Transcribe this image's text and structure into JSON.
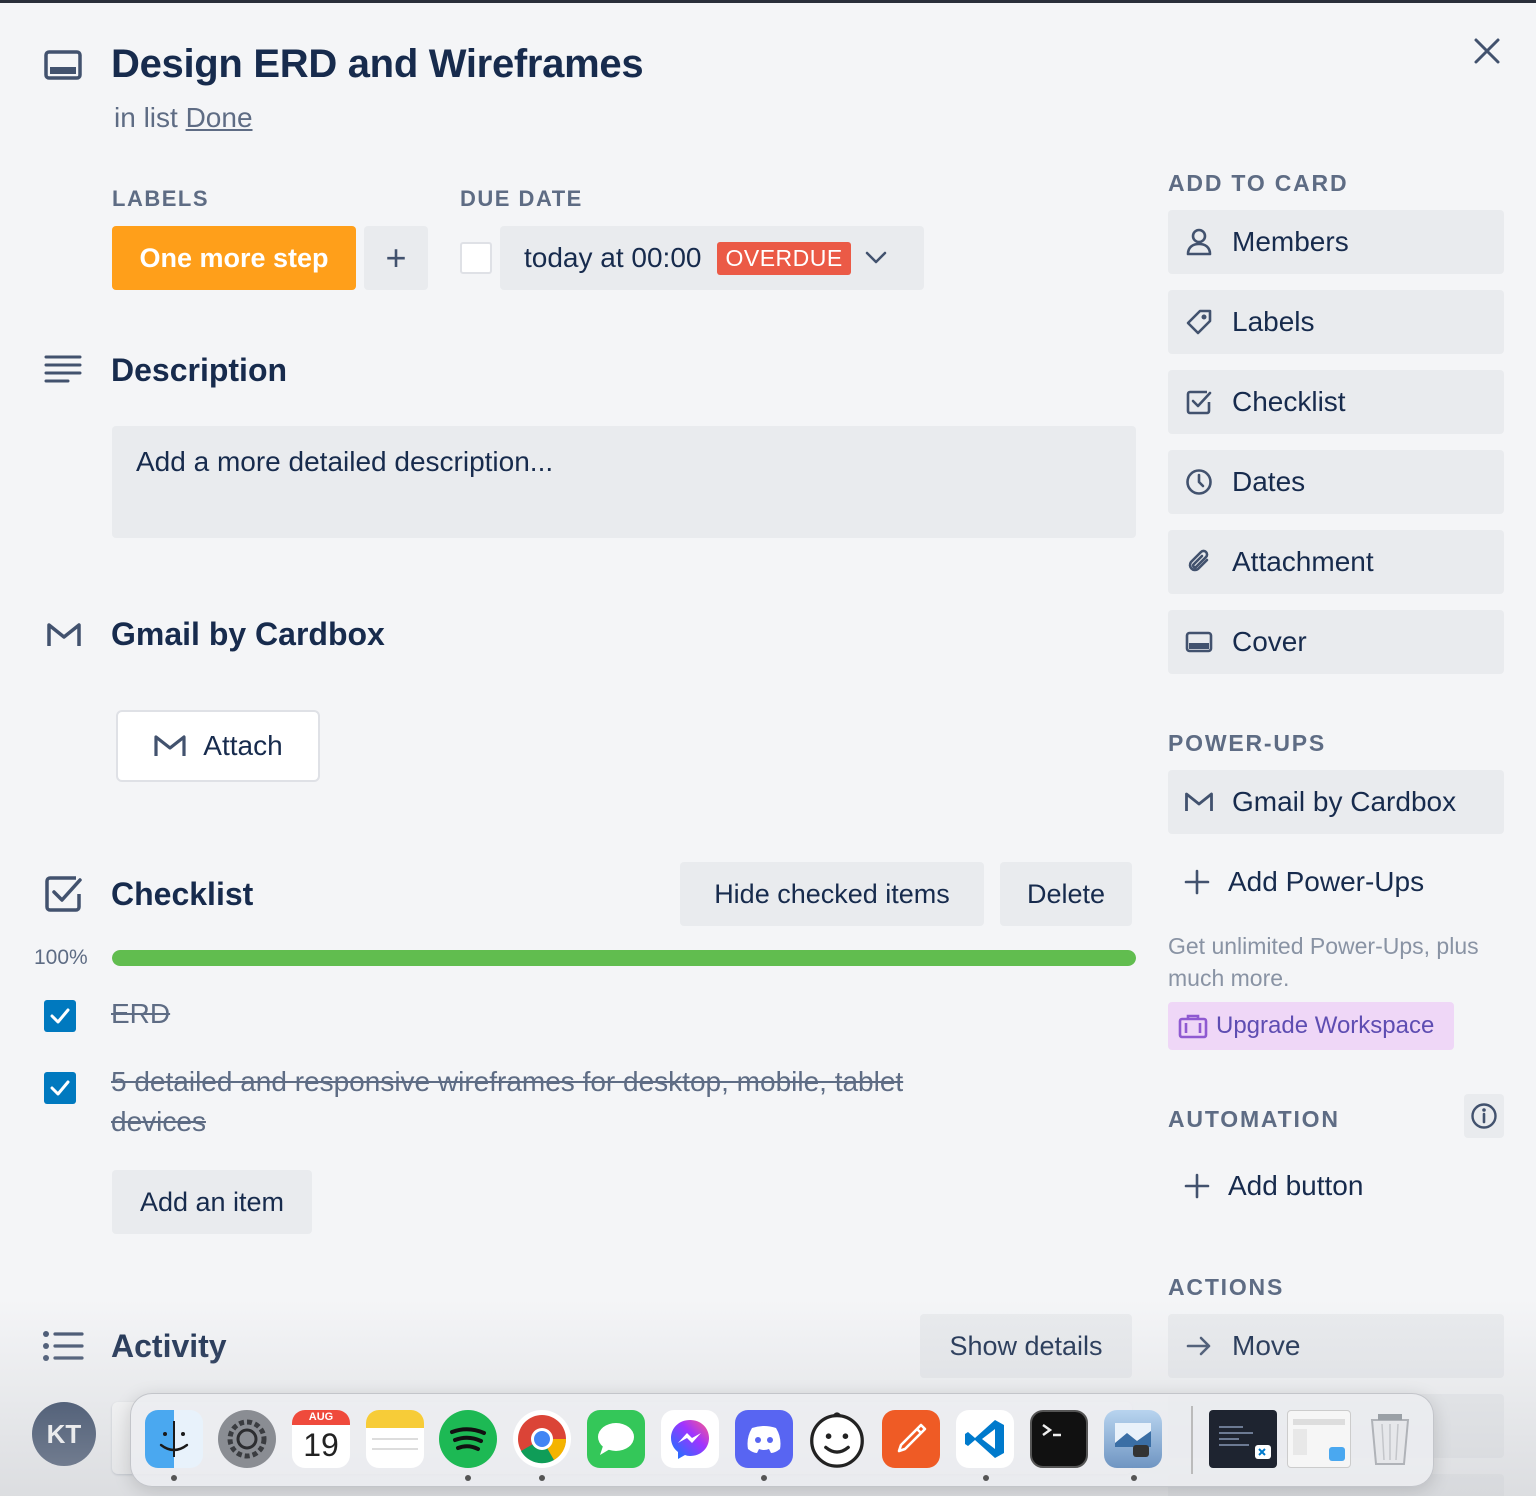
{
  "card": {
    "title": "Design ERD and Wireframes",
    "in_list_prefix": "in list",
    "list_name": "Done"
  },
  "labels": {
    "heading": "LABELS",
    "items": [
      {
        "text": "One more step",
        "color": "#ff9f1a"
      }
    ],
    "add_symbol": "+"
  },
  "due_date": {
    "heading": "DUE DATE",
    "value": "today at 00:00",
    "badge": "OVERDUE",
    "badge_color": "#eb5a46",
    "completed": false
  },
  "description": {
    "heading": "Description",
    "placeholder": "Add a more detailed description..."
  },
  "gmail_section": {
    "heading": "Gmail by Cardbox",
    "attach_label": "Attach"
  },
  "checklist": {
    "heading": "Checklist",
    "hide_checked_label": "Hide checked items",
    "delete_label": "Delete",
    "progress_text": "100%",
    "progress": 1.0,
    "items": [
      {
        "text": "ERD",
        "checked": true
      },
      {
        "text": "5 detailed and responsive wireframes for desktop, mobile, tablet devices",
        "checked": true
      }
    ],
    "add_item_label": "Add an item"
  },
  "activity": {
    "heading": "Activity",
    "show_details_label": "Show details",
    "avatar_initials": "KT"
  },
  "sidebar": {
    "add_to_card_heading": "ADD TO CARD",
    "add_to_card": [
      {
        "label": "Members",
        "icon": "person-icon"
      },
      {
        "label": "Labels",
        "icon": "tag-icon"
      },
      {
        "label": "Checklist",
        "icon": "checkbox-icon"
      },
      {
        "label": "Dates",
        "icon": "clock-icon"
      },
      {
        "label": "Attachment",
        "icon": "paperclip-icon"
      },
      {
        "label": "Cover",
        "icon": "cover-icon"
      }
    ],
    "powerups_heading": "POWER-UPS",
    "powerup_gmail": "Gmail by Cardbox",
    "add_powerups": "Add Power-Ups",
    "promo_text": "Get unlimited Power-Ups, plus much more.",
    "upgrade_label": "Upgrade Workspace",
    "automation_heading": "AUTOMATION",
    "add_button_label": "Add button",
    "actions_heading": "ACTIONS",
    "move_label": "Move"
  },
  "dock": {
    "calendar_month": "AUG",
    "calendar_day": "19",
    "apps": [
      "Finder",
      "System Preferences",
      "Calendar",
      "Notes",
      "Spotify",
      "Chrome",
      "Messages",
      "Messenger",
      "Discord",
      "Smiley",
      "Postman",
      "VS Code",
      "Terminal",
      "Preview",
      "VS Code window",
      "Finder window",
      "Trash"
    ]
  },
  "colors": {
    "accent": "#0079bf",
    "progress": "#61bd4f",
    "text": "#172b4d",
    "muted": "#5e6c84"
  }
}
